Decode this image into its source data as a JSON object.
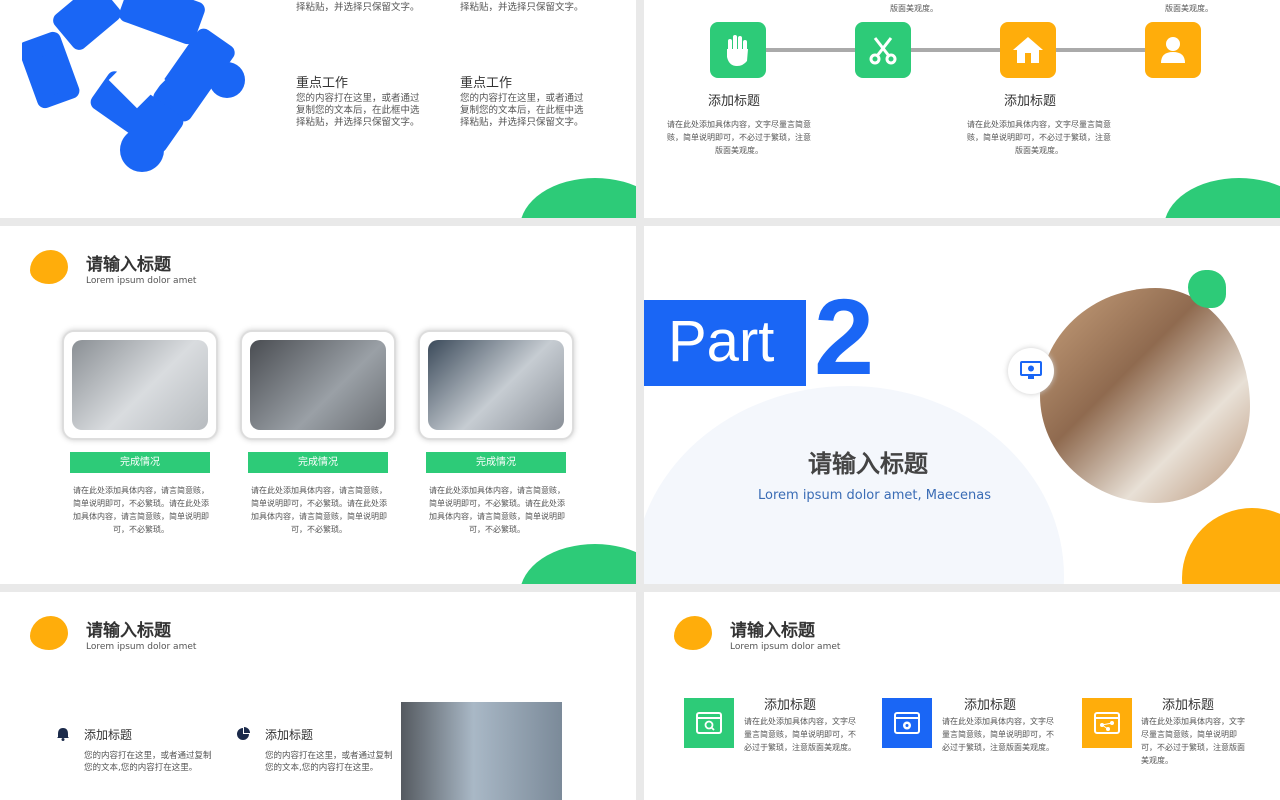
{
  "slide1": {
    "top_col1": "复制您的文本后，在此框中选择粘贴，并选择只保留文字。",
    "top_col2": "复制您的文本后，在此框中选择粘贴，并选择只保留文字。",
    "items": [
      {
        "title": "重点工作",
        "body": "您的内容打在这里，或者通过复制您的文本后，在此框中选择粘贴，并选择只保留文字。"
      },
      {
        "title": "重点工作",
        "body": "您的内容打在这里，或者通过复制您的文本后，在此框中选择粘贴，并选择只保留文字。"
      }
    ],
    "icon": "hands-teamwork-icon",
    "brand_color": "#1a66f5",
    "accent_color": "#2dcb78"
  },
  "slide2": {
    "top_note_center": "版面美观度。",
    "top_note_right": "版面美观度。",
    "icons": [
      {
        "name": "hand-icon",
        "color": "#2dcb78"
      },
      {
        "name": "scissors-icon",
        "color": "#2dcb78"
      },
      {
        "name": "home-icon",
        "color": "#ffad0b"
      },
      {
        "name": "user-icon",
        "color": "#ffad0b"
      }
    ],
    "blocks": [
      {
        "title": "添加标题",
        "body": "请在此处添加具体内容，文字尽量言简意赅，简单说明即可，不必过于繁琐，注意版面美观度。"
      },
      {
        "title": "添加标题",
        "body": "请在此处添加具体内容，文字尽量言简意赅，简单说明即可，不必过于繁琐，注意版面美观度。"
      }
    ]
  },
  "slide3": {
    "title": "请输入标题",
    "subtitle": "Lorem ipsum dolor amet",
    "cards": [
      {
        "label": "完成情况",
        "body": "请在此处添加具体内容，请言简意赅，简单说明即可，不必繁琐。请在此处添加具体内容，请言简意赅，简单说明即可，不必繁琐。"
      },
      {
        "label": "完成情况",
        "body": "请在此处添加具体内容，请言简意赅，简单说明即可，不必繁琐。请在此处添加具体内容，请言简意赅，简单说明即可，不必繁琐。"
      },
      {
        "label": "完成情况",
        "body": "请在此处添加具体内容，请言简意赅，简单说明即可，不必繁琐。请在此处添加具体内容，请言简意赅，简单说明即可，不必繁琐。"
      }
    ]
  },
  "slide4": {
    "part_word": "Part",
    "part_number": "2",
    "title": "请输入标题",
    "subtitle": "Lorem ipsum dolor amet, Maecenas",
    "icon": "monitor-gear-icon"
  },
  "slide5": {
    "title": "请输入标题",
    "subtitle": "Lorem ipsum dolor amet",
    "items": [
      {
        "icon": "bell-icon",
        "title": "添加标题",
        "body": "您的内容打在这里，或者通过复制您的文本,您的内容打在这里。"
      },
      {
        "icon": "pie-icon",
        "title": "添加标题",
        "body": "您的内容打在这里，或者通过复制您的文本,您的内容打在这里。"
      }
    ]
  },
  "slide6": {
    "title": "请输入标题",
    "subtitle": "Lorem ipsum dolor amet",
    "items": [
      {
        "icon": "search-window-icon",
        "color": "#2dcb78",
        "title": "添加标题",
        "body": "请在此处添加具体内容，文字尽量言简意赅，简单说明即可，不必过于繁琐，注意版面美观度。"
      },
      {
        "icon": "settings-window-icon",
        "color": "#1a66f5",
        "title": "添加标题",
        "body": "请在此处添加具体内容，文字尽量言简意赅，简单说明即可，不必过于繁琐，注意版面美观度。"
      },
      {
        "icon": "network-window-icon",
        "color": "#ffad0b",
        "title": "添加标题",
        "body": "请在此处添加具体内容，文字尽量言简意赅，简单说明即可，不必过于繁琐，注意版面美观度。"
      }
    ]
  }
}
